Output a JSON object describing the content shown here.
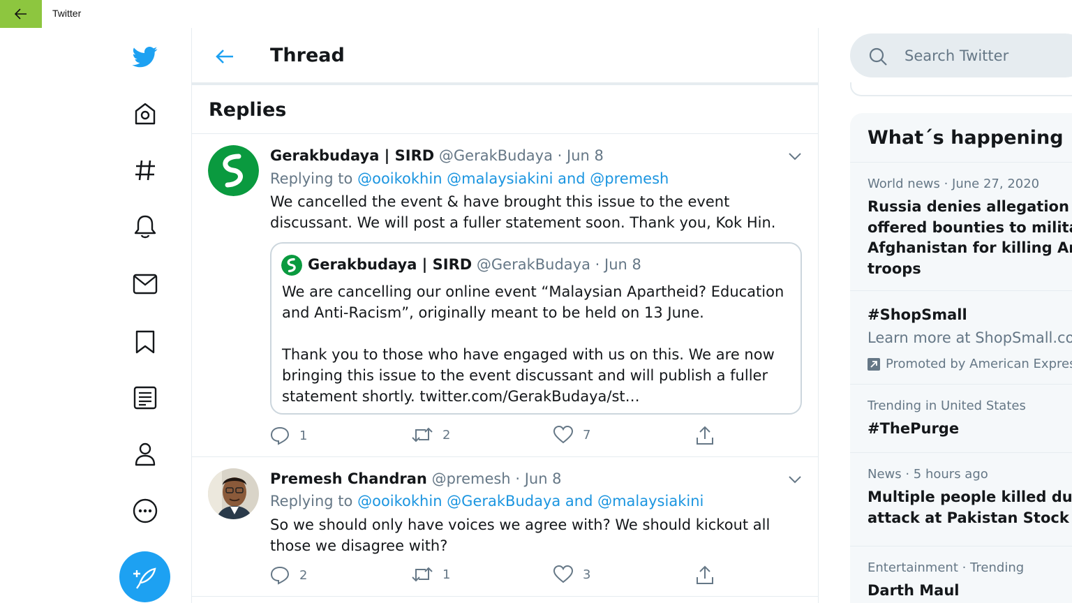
{
  "app": {
    "title": "Twitter"
  },
  "colors": {
    "accent": "#1da1f2",
    "titlebar_back": "#8dc63f",
    "link": "#1b95e0",
    "muted": "#657786"
  },
  "nav": {
    "icons": [
      "twitter-logo-icon",
      "home-icon",
      "explore-hashtag-icon",
      "notifications-bell-icon",
      "messages-mail-icon",
      "bookmarks-icon",
      "lists-icon",
      "profile-icon",
      "more-icon"
    ],
    "compose_icon": "compose-tweet-icon"
  },
  "thread": {
    "title": "Thread",
    "replies_title": "Replies"
  },
  "tweets": [
    {
      "name": "Gerakbudaya | SIRD",
      "handle": "@GerakBudaya",
      "sep": "·",
      "date": "Jun 8",
      "replying_prefix": "Replying to",
      "replying_to": "@ooikokhin @malaysiakini and @premesh",
      "text": "We cancelled the event & have brought this issue to the event discussant. We will post a fuller statement soon. Thank you, Kok Hin.",
      "quote": {
        "name": "Gerakbudaya | SIRD",
        "handle": "@GerakBudaya",
        "sep": "·",
        "date": "Jun 8",
        "text": "We are cancelling our online event “Malaysian Apartheid? Education and Anti-Racism”, originally meant to be held on 13 June.\n\nThank you to those who have engaged with us on this. We are now bringing this issue to the event discussant and will publish a fuller statement shortly. twitter.com/GerakBudaya/st…"
      },
      "replies": "1",
      "retweets": "2",
      "likes": "7"
    },
    {
      "name": "Premesh Chandran",
      "handle": "@premesh",
      "sep": "·",
      "date": "Jun 8",
      "replying_prefix": "Replying to",
      "replying_to": "@ooikokhin @GerakBudaya and @malaysiakini",
      "text": "So we should only have voices we agree with? We should kickout all those we disagree with?",
      "replies": "2",
      "retweets": "1",
      "likes": "3"
    }
  ],
  "right": {
    "search_placeholder": "Search Twitter",
    "trends_title": "What´s happening",
    "trends": [
      {
        "meta": "World news · June 27, 2020",
        "title": "Russia denies allegation that\noffered bounties to militants\nAfghanistan for killing Ame\ntroops"
      },
      {
        "title": "#ShopSmall",
        "desc": "Learn more at ShopSmall.com",
        "promo": "Promoted by American Express"
      },
      {
        "meta": "Trending in United States",
        "title": "#ThePurge"
      },
      {
        "meta": "News · 5 hours ago",
        "title": "Multiple people killed during\nattack at Pakistan Stock Exc"
      },
      {
        "meta": "Entertainment · Trending",
        "title": "Darth Maul"
      }
    ]
  }
}
